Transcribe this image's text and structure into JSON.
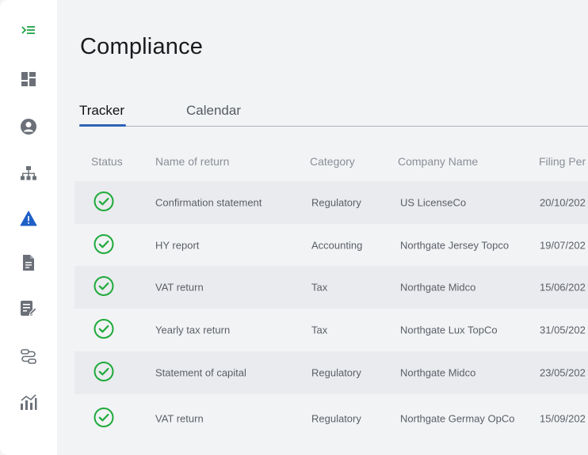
{
  "colors": {
    "accent": "#2f63b8",
    "status_ok": "#1faa3b",
    "warning_active": "#1f5fc7",
    "menu_icon": "#22a447",
    "icon_gray": "#6b7078"
  },
  "sidebar": {
    "items": [
      {
        "icon": "menu-collapse-icon",
        "active": false
      },
      {
        "icon": "dashboard-icon",
        "active": false
      },
      {
        "icon": "user-icon",
        "active": false
      },
      {
        "icon": "org-chart-icon",
        "active": false
      },
      {
        "icon": "warning-icon",
        "active": true
      },
      {
        "icon": "document-icon",
        "active": false
      },
      {
        "icon": "edit-document-icon",
        "active": false
      },
      {
        "icon": "workflow-icon",
        "active": false
      },
      {
        "icon": "analytics-icon",
        "active": false
      }
    ]
  },
  "page": {
    "title": "Compliance"
  },
  "tabs": [
    {
      "label": "Tracker",
      "active": true
    },
    {
      "label": "Calendar",
      "active": false
    }
  ],
  "table": {
    "headers": {
      "status": "Status",
      "name": "Name of return",
      "category": "Category",
      "company": "Company  Name",
      "date": "Filing Per"
    },
    "rows": [
      {
        "status": "complete",
        "name": "Confirmation statement",
        "category": "Regulatory",
        "company": "US LicenseCo",
        "date": "20/10/202"
      },
      {
        "status": "complete",
        "name": "HY report",
        "category": "Accounting",
        "company": "Northgate Jersey Topco",
        "date": "19/07/202"
      },
      {
        "status": "complete",
        "name": "VAT return",
        "category": "Tax",
        "company": "Northgate Midco",
        "date": "15/06/202"
      },
      {
        "status": "complete",
        "name": "Yearly tax return",
        "category": "Tax",
        "company": "Northgate Lux TopCo",
        "date": "31/05/202"
      },
      {
        "status": "complete",
        "name": "Statement of capital",
        "category": "Regulatory",
        "company": "Northgate Midco",
        "date": "23/05/202"
      },
      {
        "status": "complete",
        "name": "VAT return",
        "category": "Regulatory",
        "company": "Northgate Germay OpCo",
        "date": "15/09/202"
      }
    ]
  }
}
